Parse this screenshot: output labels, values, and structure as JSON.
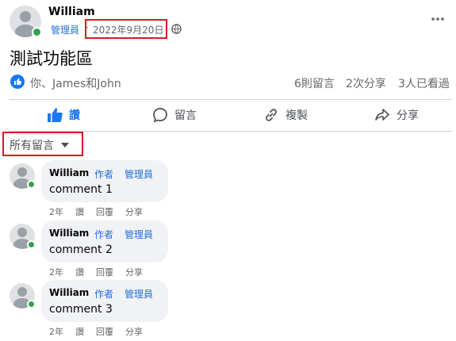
{
  "post": {
    "author": "William",
    "role_badge": "管理員",
    "separator": "·",
    "date": "2022年9月20日",
    "title": "測試功能區",
    "reactions_text": "你、James和John",
    "stats": {
      "comments": "6則留言",
      "shares": "2次分享",
      "views": "3人已看過"
    }
  },
  "actions": {
    "like": "讚",
    "comment": "留言",
    "copy": "複製",
    "share": "分享"
  },
  "filter": {
    "label": "所有留言"
  },
  "comments": [
    {
      "author": "William",
      "tag_author": "作者",
      "tag_admin": "管理員",
      "text": "comment 1",
      "time": "2年",
      "like": "讚",
      "reply": "回覆",
      "share": "分享"
    },
    {
      "author": "William",
      "tag_author": "作者",
      "tag_admin": "管理員",
      "text": "comment 2",
      "time": "2年",
      "like": "讚",
      "reply": "回覆",
      "share": "分享"
    },
    {
      "author": "William",
      "tag_author": "作者",
      "tag_admin": "管理員",
      "text": "comment 3",
      "time": "2年",
      "like": "讚",
      "reply": "回覆",
      "share": "分享"
    }
  ],
  "colors": {
    "accent": "#216fdb",
    "highlight_box": "#e1161e",
    "online": "#31a24c",
    "bubble": "#f0f2f5"
  },
  "icons": [
    "more-icon",
    "globe-icon",
    "like-icon",
    "comment-icon",
    "link-icon",
    "share-icon",
    "caret-down-icon"
  ]
}
